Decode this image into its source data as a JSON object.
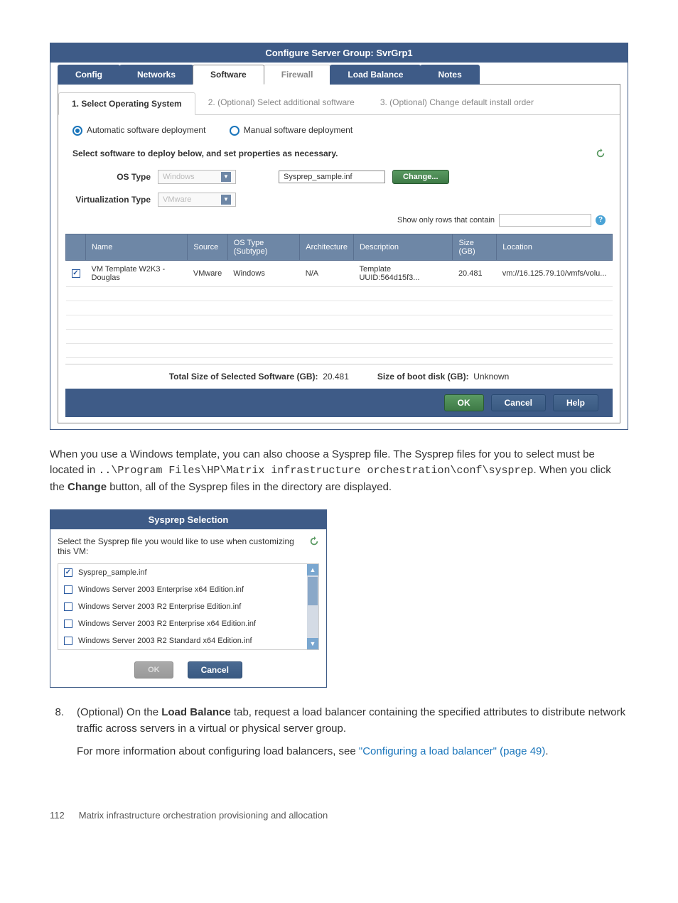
{
  "fig1": {
    "title": "Configure Server Group: SvrGrp1",
    "tabs": [
      "Config",
      "Networks",
      "Software",
      "Firewall",
      "Load Balance",
      "Notes"
    ],
    "steps": [
      "1. Select Operating System",
      "2. (Optional) Select additional software",
      "3. (Optional) Change default install order"
    ],
    "radio_auto": "Automatic software deployment",
    "radio_manual": "Manual software deployment",
    "section_label": "Select software to deploy below, and set properties as necessary.",
    "os_type_label": "OS Type",
    "os_type_value": "Windows",
    "virt_type_label": "Virtualization Type",
    "virt_type_value": "VMware",
    "sysprep_value": "Sysprep_sample.inf",
    "change_btn": "Change...",
    "filter_label": "Show only rows that contain",
    "columns": [
      "",
      "Name",
      "Source",
      "OS Type (Subtype)",
      "Architecture",
      "Description",
      "Size (GB)",
      "Location"
    ],
    "rows": [
      {
        "checked": true,
        "name": "VM Template W2K3 - Douglas",
        "source": "VMware",
        "ostype": "Windows",
        "arch": "N/A",
        "desc": "Template UUID:564d15f3... ",
        "size": "20.481",
        "loc": "vm://16.125.79.10/vmfs/volu..."
      }
    ],
    "total_label": "Total Size of Selected Software (GB):",
    "total_value": "20.481",
    "boot_label": "Size of boot disk (GB):",
    "boot_value": "Unknown",
    "ok": "OK",
    "cancel": "Cancel",
    "help": "Help"
  },
  "para1_a": "When you use a Windows template, you can also choose a Sysprep file. The Sysprep files for you to select must be located in ",
  "para1_mono": "..\\Program Files\\HP\\Matrix infrastructure orchestration\\conf\\sysprep",
  "para1_b": ". When you click the ",
  "para1_bold": "Change",
  "para1_c": " button, all of the Sysprep files in the directory are displayed.",
  "fig2": {
    "title": "Sysprep Selection",
    "prompt": "Select the Sysprep file you would like to use when customizing this VM:",
    "items": [
      {
        "checked": true,
        "label": "Sysprep_sample.inf"
      },
      {
        "checked": false,
        "label": "Windows Server 2003 Enterprise x64 Edition.inf"
      },
      {
        "checked": false,
        "label": "Windows Server 2003 R2 Enterprise Edition.inf"
      },
      {
        "checked": false,
        "label": "Windows Server 2003 R2 Enterprise x64 Edition.inf"
      },
      {
        "checked": false,
        "label": "Windows Server 2003 R2 Standard x64 Edition.inf"
      }
    ],
    "ok": "OK",
    "cancel": "Cancel"
  },
  "step8": {
    "num": "8.",
    "p1a": "(Optional) On the ",
    "p1bold": "Load Balance",
    "p1b": " tab, request a load balancer containing the specified attributes to distribute network traffic across servers in a virtual or physical server group.",
    "p2a": "For more information about configuring load balancers, see ",
    "p2link": "\"Configuring a load balancer\" (page 49)",
    "p2b": "."
  },
  "footer": {
    "page": "112",
    "chapter": "Matrix infrastructure orchestration provisioning and allocation"
  }
}
